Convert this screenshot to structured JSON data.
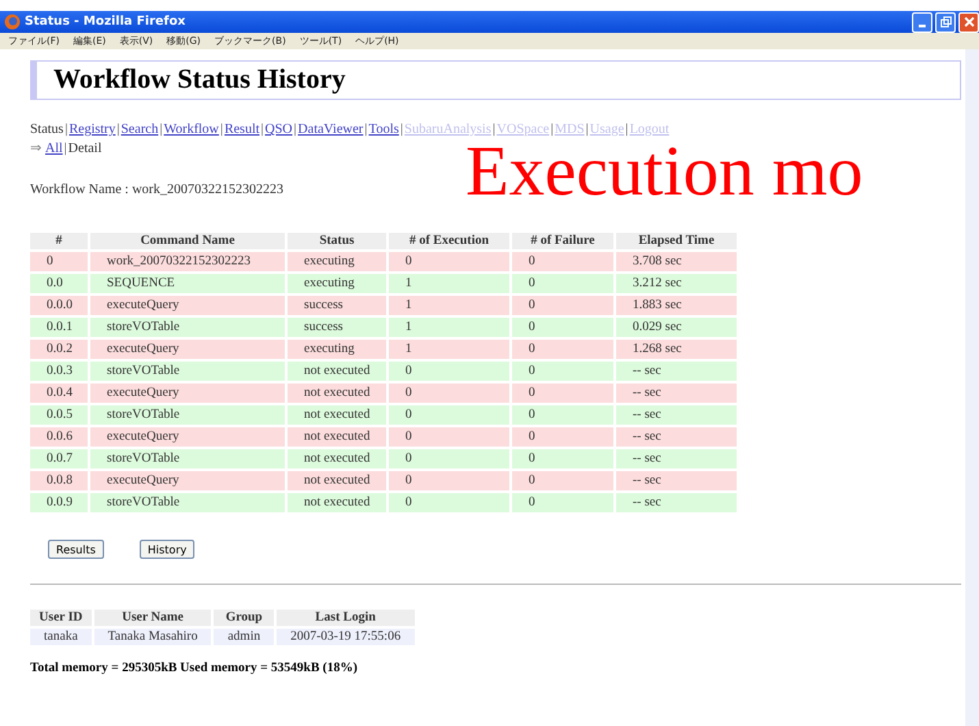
{
  "window": {
    "title": "Status - Mozilla Firefox"
  },
  "menu": [
    "ファイル(F)",
    "編集(E)",
    "表示(V)",
    "移動(G)",
    "ブックマーク(B)",
    "ツール(T)",
    "ヘルプ(H)"
  ],
  "page_title": "Workflow Status History",
  "nav_separator": "|",
  "nav": [
    {
      "label": "Status",
      "kind": "current"
    },
    {
      "label": "Registry",
      "kind": "link"
    },
    {
      "label": "Search",
      "kind": "link"
    },
    {
      "label": "Workflow",
      "kind": "link"
    },
    {
      "label": "Result",
      "kind": "link"
    },
    {
      "label": "QSO",
      "kind": "link"
    },
    {
      "label": "DataViewer",
      "kind": "link"
    },
    {
      "label": "Tools",
      "kind": "link"
    },
    {
      "label": "SubaruAnalysis",
      "kind": "disabled"
    },
    {
      "label": "VOSpace",
      "kind": "disabled"
    },
    {
      "label": "MDS",
      "kind": "disabled"
    },
    {
      "label": "Usage",
      "kind": "disabled"
    },
    {
      "label": "Logout",
      "kind": "disabled"
    }
  ],
  "subnav": {
    "arrow": "⇒",
    "items": [
      {
        "label": "All",
        "kind": "link"
      },
      {
        "label": "Detail",
        "kind": "current"
      }
    ]
  },
  "workflow_name": "Workflow Name : work_20070322152302223",
  "overlay_caption": "Execution mo",
  "table": {
    "columns": [
      "#",
      "Command Name",
      "Status",
      "# of Execution",
      "# of Failure",
      "Elapsed Time"
    ],
    "rows": [
      [
        "0",
        "work_20070322152302223",
        "executing",
        "0",
        "0",
        "3.708 sec"
      ],
      [
        "0.0",
        "SEQUENCE",
        "executing",
        "1",
        "0",
        "3.212 sec"
      ],
      [
        "0.0.0",
        "executeQuery",
        "success",
        "1",
        "0",
        "1.883 sec"
      ],
      [
        "0.0.1",
        "storeVOTable",
        "success",
        "1",
        "0",
        "0.029 sec"
      ],
      [
        "0.0.2",
        "executeQuery",
        "executing",
        "1",
        "0",
        "1.268 sec"
      ],
      [
        "0.0.3",
        "storeVOTable",
        "not executed",
        "0",
        "0",
        "-- sec"
      ],
      [
        "0.0.4",
        "executeQuery",
        "not executed",
        "0",
        "0",
        "-- sec"
      ],
      [
        "0.0.5",
        "storeVOTable",
        "not executed",
        "0",
        "0",
        "-- sec"
      ],
      [
        "0.0.6",
        "executeQuery",
        "not executed",
        "0",
        "0",
        "-- sec"
      ],
      [
        "0.0.7",
        "storeVOTable",
        "not executed",
        "0",
        "0",
        "-- sec"
      ],
      [
        "0.0.8",
        "executeQuery",
        "not executed",
        "0",
        "0",
        "-- sec"
      ],
      [
        "0.0.9",
        "storeVOTable",
        "not executed",
        "0",
        "0",
        "-- sec"
      ]
    ]
  },
  "buttons": [
    "Results",
    "History"
  ],
  "user_table": {
    "columns": [
      "User ID",
      "User Name",
      "Group",
      "Last Login"
    ],
    "rows": [
      [
        "tanaka",
        "Tanaka Masahiro",
        "admin",
        "2007-03-19 17:55:06"
      ]
    ]
  },
  "memory": "Total memory = 295305kB Used memory = 53549kB (18%)"
}
